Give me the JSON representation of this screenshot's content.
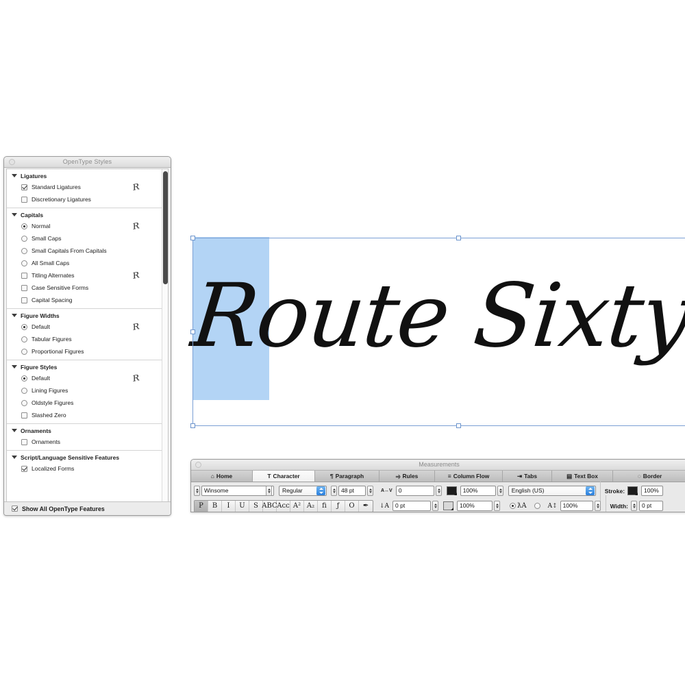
{
  "opentype_panel": {
    "title": "OpenType Styles",
    "groups": [
      {
        "name": "Ligatures",
        "options": [
          {
            "label": "Standard Ligatures",
            "type": "checkbox",
            "checked": true,
            "swash": true
          },
          {
            "label": "Discretionary Ligatures",
            "type": "checkbox",
            "checked": false,
            "swash": false
          }
        ]
      },
      {
        "name": "Capitals",
        "options": [
          {
            "label": "Normal",
            "type": "radio",
            "checked": true,
            "swash": true
          },
          {
            "label": "Small Caps",
            "type": "radio",
            "checked": false,
            "swash": false
          },
          {
            "label": "Small Capitals From Capitals",
            "type": "radio",
            "checked": false,
            "swash": false
          },
          {
            "label": "All Small Caps",
            "type": "radio",
            "checked": false,
            "swash": false
          },
          {
            "label": "Titling Alternates",
            "type": "checkbox",
            "checked": false,
            "swash": true
          },
          {
            "label": "Case Sensitive Forms",
            "type": "checkbox",
            "checked": false,
            "swash": false
          },
          {
            "label": "Capital Spacing",
            "type": "checkbox",
            "checked": false,
            "swash": false
          }
        ]
      },
      {
        "name": "Figure Widths",
        "options": [
          {
            "label": "Default",
            "type": "radio",
            "checked": true,
            "swash": true
          },
          {
            "label": "Tabular Figures",
            "type": "radio",
            "checked": false,
            "swash": false
          },
          {
            "label": "Proportional Figures",
            "type": "radio",
            "checked": false,
            "swash": false
          }
        ]
      },
      {
        "name": "Figure Styles",
        "options": [
          {
            "label": "Default",
            "type": "radio",
            "checked": true,
            "swash": true
          },
          {
            "label": "Lining Figures",
            "type": "radio",
            "checked": false,
            "swash": false
          },
          {
            "label": "Oldstyle Figures",
            "type": "radio",
            "checked": false,
            "swash": false
          },
          {
            "label": "Slashed Zero",
            "type": "checkbox",
            "checked": false,
            "swash": false
          }
        ]
      },
      {
        "name": "Ornaments",
        "options": [
          {
            "label": "Ornaments",
            "type": "checkbox",
            "checked": false,
            "swash": false
          }
        ]
      },
      {
        "name": "Script/Language Sensitive Features",
        "options": [
          {
            "label": "Localized Forms",
            "type": "checkbox",
            "checked": true,
            "swash": false
          }
        ]
      }
    ],
    "footer": {
      "label": "Show All OpenType Features",
      "checked": true
    },
    "swash_glyph": "R"
  },
  "document": {
    "text": "Route Sixty Six",
    "selection_highlight_color": "#b3d4f5",
    "selection_frame_color": "#7a9fd4"
  },
  "measurements": {
    "title": "Measurements",
    "tabs": [
      {
        "label": "Home",
        "icon": "home-icon",
        "glyph": "⌂",
        "active": false
      },
      {
        "label": "Character",
        "icon": "character-icon",
        "glyph": "T",
        "active": true
      },
      {
        "label": "Paragraph",
        "icon": "paragraph-icon",
        "glyph": "¶",
        "active": false
      },
      {
        "label": "Rules",
        "icon": "rules-icon",
        "glyph": "⥤",
        "active": false
      },
      {
        "label": "Column Flow",
        "icon": "column-flow-icon",
        "glyph": "≡",
        "active": false
      },
      {
        "label": "Tabs",
        "icon": "tabs-icon",
        "glyph": "⇥",
        "active": false
      },
      {
        "label": "Text Box",
        "icon": "text-box-icon",
        "glyph": "▤",
        "active": false
      },
      {
        "label": "Border",
        "icon": "border-icon",
        "glyph": "◌",
        "active": false
      }
    ],
    "character": {
      "font_family": "Winsome",
      "font_style": "Regular",
      "font_size": "48 pt",
      "tracking_label": "A↔V",
      "tracking_value": "0",
      "baseline_shift_label": "↓A",
      "baseline_shift_value": "0 pt",
      "horizontal_scale": "100%",
      "vertical_scale": "100%",
      "language": "English (US)",
      "opacity": "100%",
      "style_buttons": [
        {
          "name": "plain",
          "glyph": "P",
          "active": true
        },
        {
          "name": "bold",
          "glyph": "B",
          "active": false
        },
        {
          "name": "italic",
          "glyph": "I",
          "active": false
        },
        {
          "name": "underline",
          "glyph": "U",
          "active": false
        },
        {
          "name": "strikethrough",
          "glyph": "S",
          "active": false
        },
        {
          "name": "all-caps",
          "glyph": "ABC",
          "active": false
        },
        {
          "name": "small-caps",
          "glyph": "Aᴄᴄ",
          "active": false
        },
        {
          "name": "superscript",
          "glyph": "A²",
          "active": false
        },
        {
          "name": "subscript",
          "glyph": "A₂",
          "active": false
        },
        {
          "name": "ligature",
          "glyph": "fi",
          "active": false
        },
        {
          "name": "font-script",
          "glyph": "ƒ",
          "active": false
        },
        {
          "name": "outline",
          "glyph": "O",
          "active": false
        },
        {
          "name": "shadow",
          "glyph": "✒",
          "active": false
        }
      ]
    },
    "border": {
      "stroke_label": "Stroke:",
      "stroke_value": "100%",
      "width_label": "Width:",
      "width_value": "0 pt"
    }
  }
}
